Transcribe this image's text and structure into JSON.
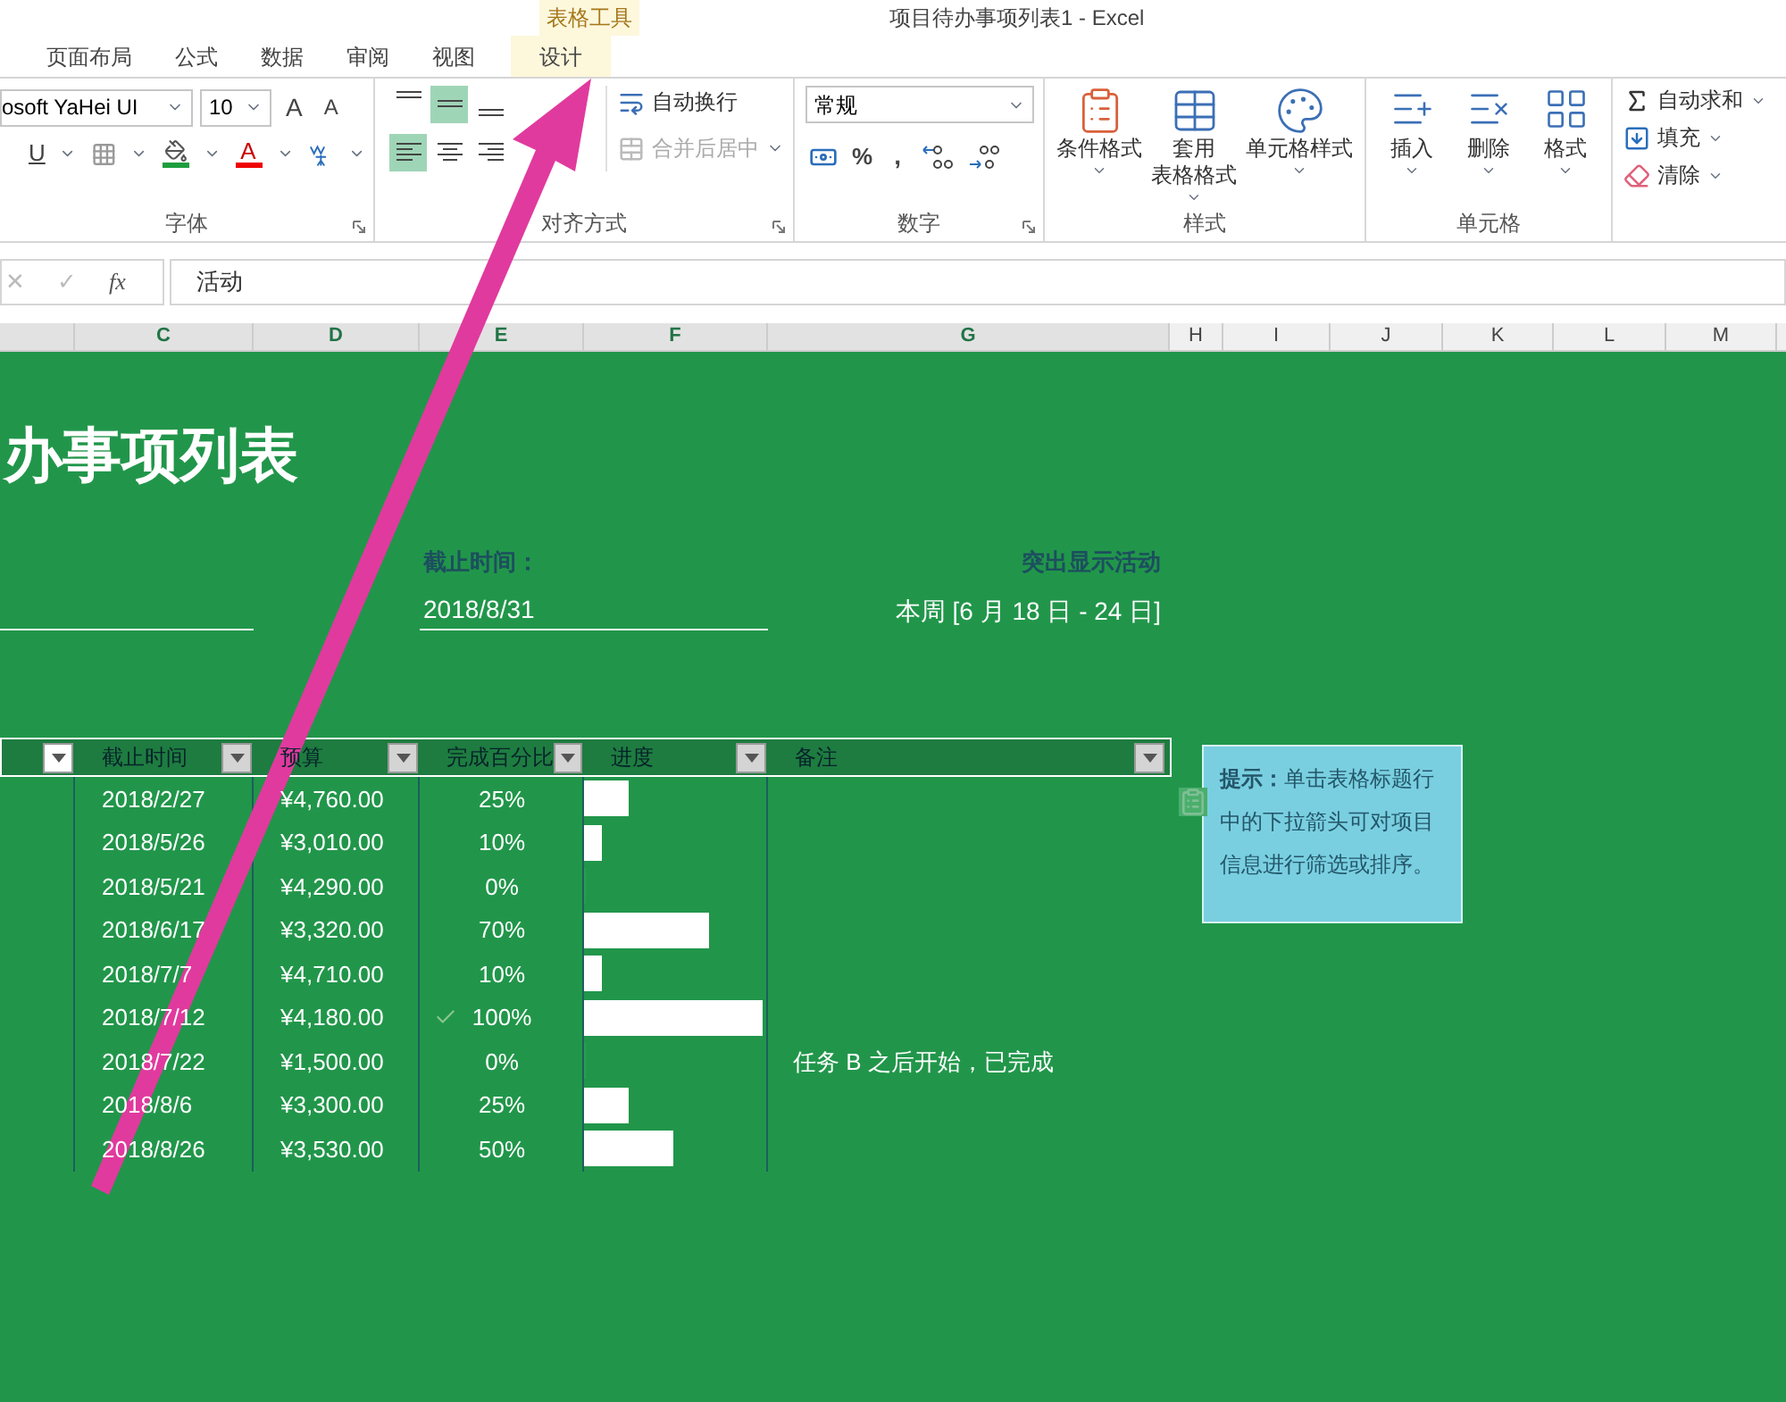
{
  "window": {
    "title": "项目待办事项列表1 - Excel",
    "context_tab": "表格工具"
  },
  "tabs": [
    {
      "label": "页面布局",
      "selected": false
    },
    {
      "label": "公式",
      "selected": false
    },
    {
      "label": "数据",
      "selected": false
    },
    {
      "label": "审阅",
      "selected": false
    },
    {
      "label": "视图",
      "selected": false
    },
    {
      "label": "设计",
      "selected": true
    }
  ],
  "ribbon": {
    "font": {
      "font_name": "osoft YaHei UI",
      "font_size": "10",
      "grow": "A",
      "shrink": "A",
      "underline": "U",
      "font_color": "A",
      "label": "字体"
    },
    "alignment": {
      "vertical": [
        {
          "kind": "top",
          "selected": false
        },
        {
          "kind": "middle",
          "selected": true
        },
        {
          "kind": "bottom",
          "selected": false
        }
      ],
      "horizontal": [
        {
          "kind": "left",
          "selected": true
        },
        {
          "kind": "center",
          "selected": false
        },
        {
          "kind": "right",
          "selected": false
        }
      ],
      "wrap": {
        "label": "自动换行",
        "disabled": false
      },
      "merge": {
        "label": "合并后居中",
        "disabled": true
      },
      "label": "对齐方式"
    },
    "number": {
      "format": "常规",
      "percent": "%",
      "comma": ",",
      "label": "数字"
    },
    "styles": {
      "buttons": [
        {
          "kind": "conditional",
          "lines": [
            "条件格式"
          ]
        },
        {
          "kind": "table",
          "lines": [
            "套用",
            "表格格式"
          ]
        },
        {
          "kind": "cell",
          "lines": [
            "单元格样式"
          ]
        }
      ],
      "label": "样式"
    },
    "cells": {
      "buttons": [
        {
          "kind": "insert",
          "label": "插入"
        },
        {
          "kind": "delete",
          "label": "删除"
        },
        {
          "kind": "format",
          "label": "格式"
        }
      ],
      "label": "单元格"
    },
    "editing": [
      {
        "kind": "sum",
        "label": "自动求和"
      },
      {
        "kind": "fill",
        "label": "填充"
      },
      {
        "kind": "clear",
        "label": "清除"
      }
    ]
  },
  "formula_bar": {
    "cancel": "✕",
    "enter": "✓",
    "fx": "fx",
    "value": "活动"
  },
  "column_headers": [
    {
      "label": "C",
      "selected": true
    },
    {
      "label": "D",
      "selected": true
    },
    {
      "label": "E",
      "selected": true
    },
    {
      "label": "F",
      "selected": true
    },
    {
      "label": "G",
      "selected": true
    },
    {
      "label": "H",
      "selected": false
    },
    {
      "label": "I",
      "selected": false
    },
    {
      "label": "J",
      "selected": false
    },
    {
      "label": "K",
      "selected": false
    },
    {
      "label": "L",
      "selected": false
    },
    {
      "label": "M",
      "selected": false
    }
  ],
  "sheet": {
    "title": "办事项列表",
    "deadline_label": "截止时间：",
    "deadline": "2018/8/31",
    "highlight_label": "突出显示活动",
    "week": "本周 [6 月 18 日 - 24 日]",
    "table": {
      "columns": [
        "截止时间",
        "预算",
        "完成百分比",
        "进度",
        "备注"
      ],
      "rows": [
        {
          "date": "2018/2/27",
          "budget": "¥4,760.00",
          "done": false,
          "percent": "25%",
          "level": 0.25
        },
        {
          "date": "2018/5/26",
          "budget": "¥3,010.00",
          "done": false,
          "percent": "10%",
          "level": 0.1
        },
        {
          "date": "2018/5/21",
          "budget": "¥4,290.00",
          "done": false,
          "percent": "0%",
          "level": 0
        },
        {
          "date": "2018/6/17",
          "budget": "¥3,320.00",
          "done": false,
          "percent": "70%",
          "level": 0.7
        },
        {
          "date": "2018/7/7",
          "budget": "¥4,710.00",
          "done": false,
          "percent": "10%",
          "level": 0.1
        },
        {
          "date": "2018/7/12",
          "budget": "¥4,180.00",
          "done": true,
          "percent": "100%",
          "level": 1
        },
        {
          "date": "2018/7/22",
          "budget": "¥1,500.00",
          "done": false,
          "percent": "0%",
          "level": 0,
          "note": "任务 B 之后开始，已完成"
        },
        {
          "date": "2018/8/6",
          "budget": "¥3,300.00",
          "done": false,
          "percent": "25%",
          "level": 0.25
        },
        {
          "date": "2018/8/26",
          "budget": "¥3,530.00",
          "done": false,
          "percent": "50%",
          "level": 0.5
        }
      ]
    },
    "tip": "**提示：**单击表格标题行中的下拉箭头可对项目信息进行筛选或排序。"
  }
}
